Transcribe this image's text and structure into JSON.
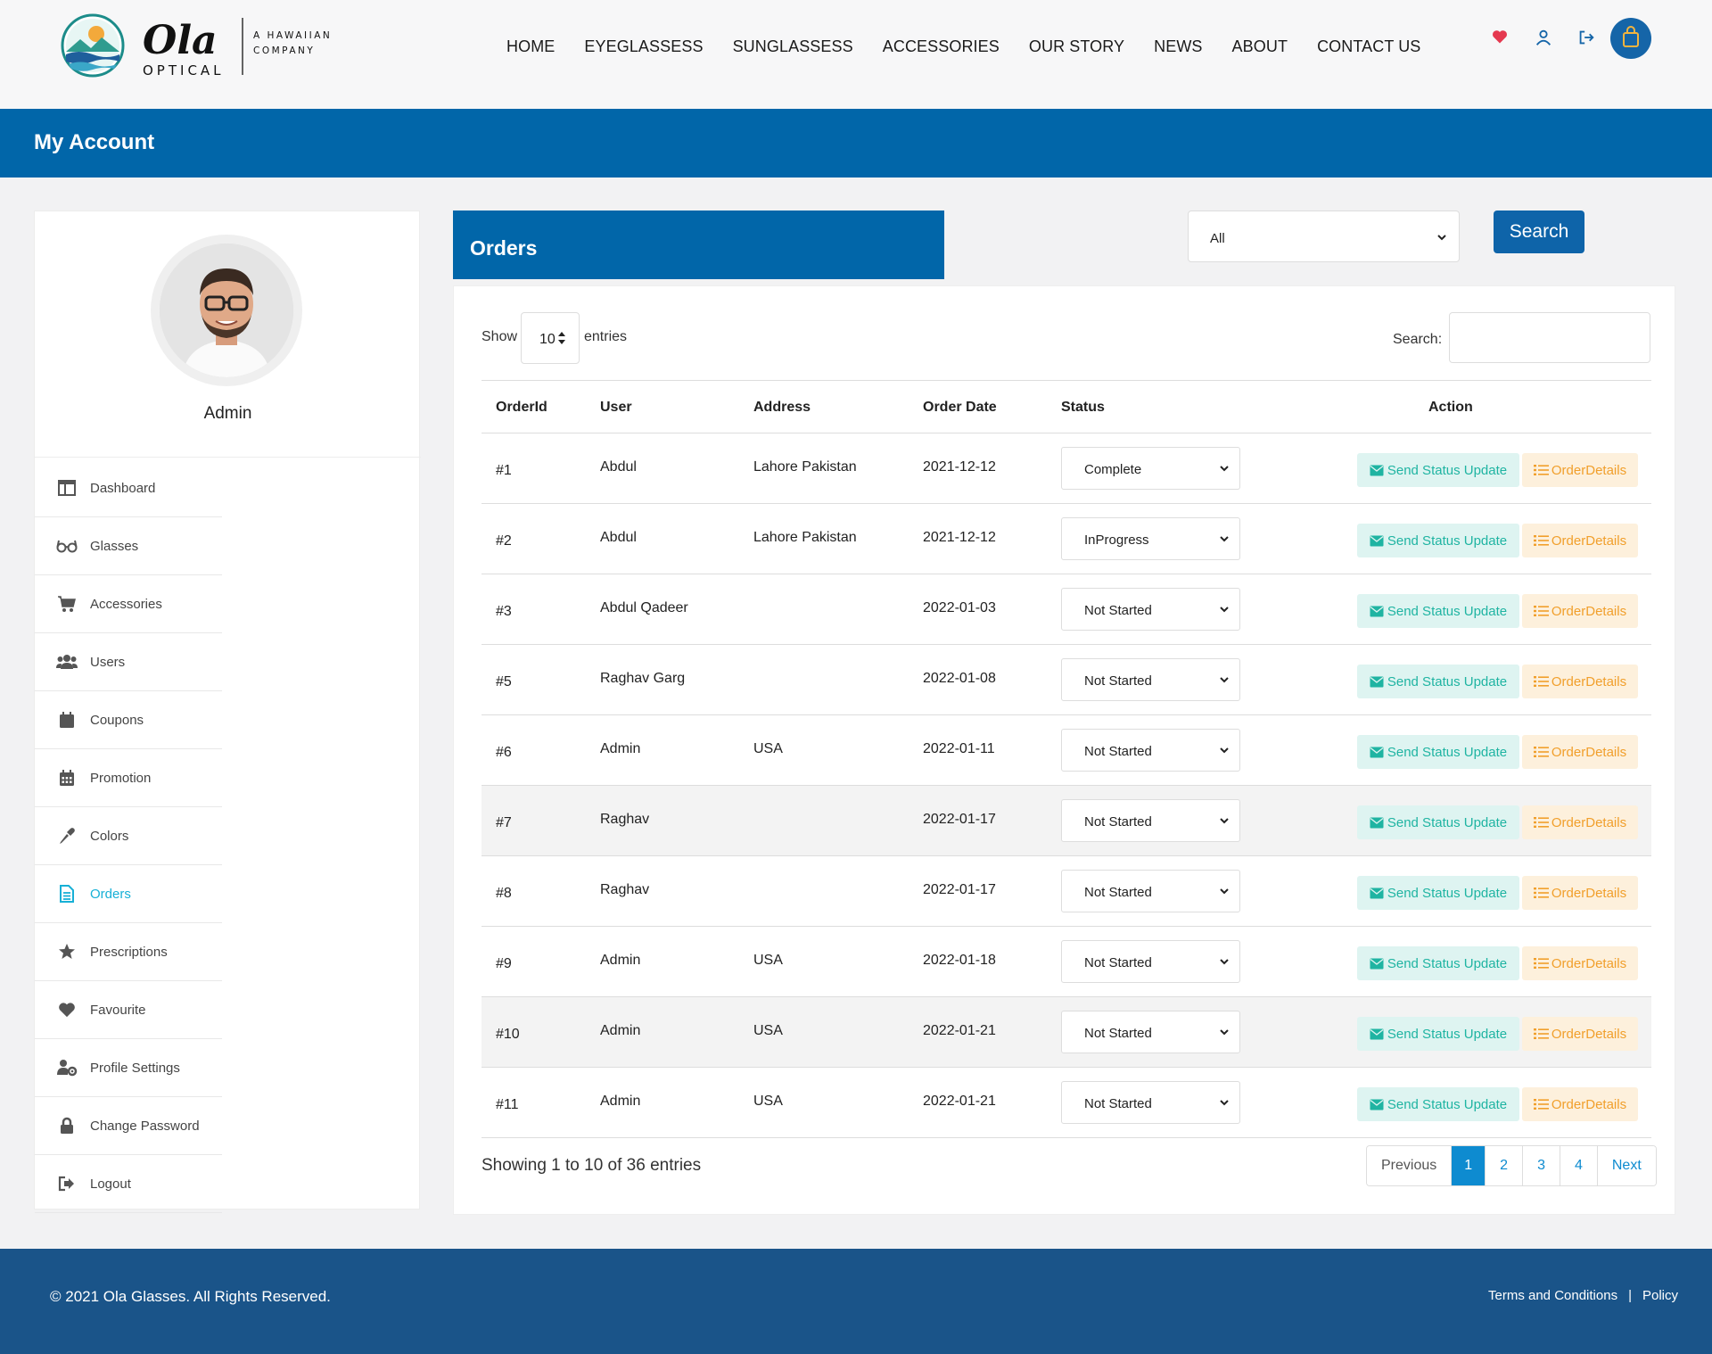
{
  "brand": {
    "name": "Ola",
    "sub": "OPTICAL",
    "tagline_1": "A HAWAIIAN",
    "tagline_2": "COMPANY"
  },
  "nav": [
    "HOME",
    "EYEGLASSESS",
    "SUNGLASSESS",
    "ACCESSORIES",
    "OUR STORY",
    "NEWS",
    "ABOUT",
    "CONTACT US"
  ],
  "header_icons": [
    "heart-icon",
    "user-icon",
    "logout-icon",
    "shopping-bag-icon"
  ],
  "banner": {
    "title": "My Account"
  },
  "profile": {
    "name": "Admin"
  },
  "sidebar": {
    "items": [
      {
        "label": "Dashboard",
        "icon": "dashboard-icon"
      },
      {
        "label": "Glasses",
        "icon": "glasses-icon"
      },
      {
        "label": "Accessories",
        "icon": "cart-icon"
      },
      {
        "label": "Users",
        "icon": "users-icon"
      },
      {
        "label": "Coupons",
        "icon": "calendar-icon"
      },
      {
        "label": "Promotion",
        "icon": "calendar-grid-icon"
      },
      {
        "label": "Colors",
        "icon": "eyedropper-icon"
      },
      {
        "label": "Orders",
        "icon": "document-icon",
        "active": true
      },
      {
        "label": "Prescriptions",
        "icon": "star-icon"
      },
      {
        "label": "Favourite",
        "icon": "heart-icon"
      },
      {
        "label": "Profile Settings",
        "icon": "user-gear-icon"
      },
      {
        "label": "Change Password",
        "icon": "lock-icon"
      },
      {
        "label": "Logout",
        "icon": "logout-icon"
      }
    ]
  },
  "orders": {
    "title": "Orders",
    "filter_value": "All",
    "search_button": "Search",
    "show_label": "Show",
    "page_length": "10",
    "entries_label": "entries",
    "search_label": "Search:",
    "columns": [
      "OrderId",
      "User",
      "Address",
      "Order Date",
      "Status",
      "Action"
    ],
    "send_label": "Send Status Update",
    "details_label": "OrderDetails",
    "rows": [
      {
        "id": "#1",
        "user": "Abdul",
        "address": "Lahore Pakistan",
        "date": "2021-12-12",
        "status": "Complete"
      },
      {
        "id": "#2",
        "user": "Abdul",
        "address": "Lahore Pakistan",
        "date": "2021-12-12",
        "status": "InProgress"
      },
      {
        "id": "#3",
        "user": "Abdul Qadeer",
        "address": "",
        "date": "2022-01-03",
        "status": "Not Started"
      },
      {
        "id": "#5",
        "user": "Raghav Garg",
        "address": "",
        "date": "2022-01-08",
        "status": "Not Started"
      },
      {
        "id": "#6",
        "user": "Admin",
        "address": "USA",
        "date": "2022-01-11",
        "status": "Not Started"
      },
      {
        "id": "#7",
        "user": "Raghav",
        "address": "",
        "date": "2022-01-17",
        "status": "Not Started"
      },
      {
        "id": "#8",
        "user": "Raghav",
        "address": "",
        "date": "2022-01-17",
        "status": "Not Started"
      },
      {
        "id": "#9",
        "user": "Admin",
        "address": "USA",
        "date": "2022-01-18",
        "status": "Not Started"
      },
      {
        "id": "#10",
        "user": "Admin",
        "address": "USA",
        "date": "2022-01-21",
        "status": "Not Started"
      },
      {
        "id": "#11",
        "user": "Admin",
        "address": "USA",
        "date": "2022-01-21",
        "status": "Not Started"
      }
    ],
    "showing_text": "Showing 1 to 10 of 36 entries",
    "pagination": {
      "previous": "Previous",
      "pages": [
        "1",
        "2",
        "3",
        "4"
      ],
      "current": "1",
      "next": "Next"
    }
  },
  "footer": {
    "copyright": "© 2021 Ola Glasses. All Rights Reserved.",
    "terms": "Terms and Conditions",
    "separator": "|",
    "policy": "Policy"
  },
  "colors": {
    "primary": "#0166a9",
    "footer": "#1a5489",
    "active_menu": "#17b0d6",
    "send_btn_text": "#1fb4a2",
    "details_btn_text": "#f19f2b",
    "pager_active": "#0e8bd0"
  }
}
